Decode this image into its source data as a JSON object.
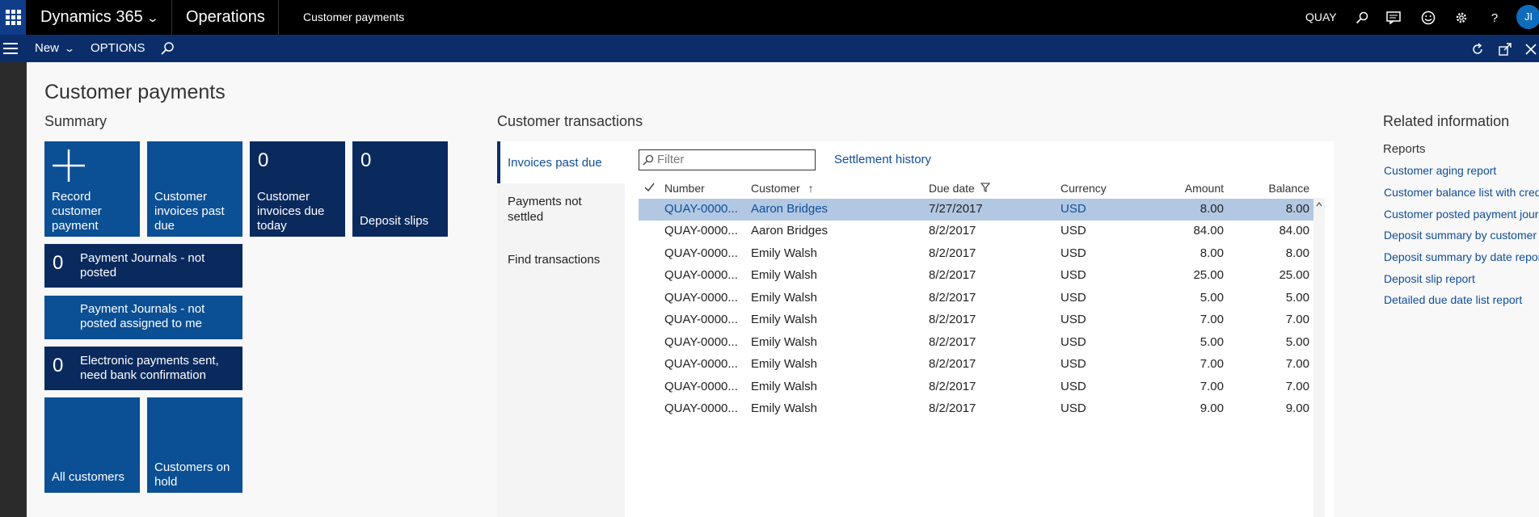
{
  "topbar": {
    "brand": "Dynamics 365",
    "module": "Operations",
    "page": "Customer payments",
    "company": "QUAY",
    "user_initials": "JI",
    "icons": [
      "search-icon",
      "message-icon",
      "smiley-icon",
      "gear-icon",
      "help-icon"
    ]
  },
  "actionbar": {
    "new_label": "New",
    "options_label": "OPTIONS"
  },
  "page_title": "Customer payments",
  "summary": {
    "heading": "Summary",
    "tiles": {
      "record_payment": "Record customer payment",
      "invoices_past_due": "Customer invoices past due",
      "invoices_due_today_count": "0",
      "invoices_due_today": "Customer invoices due today",
      "deposit_slips_count": "0",
      "deposit_slips": "Deposit slips",
      "journals_not_posted_count": "0",
      "journals_not_posted": "Payment Journals - not posted",
      "journals_assigned": "Payment Journals - not posted assigned to me",
      "electronic_count": "0",
      "electronic": "Electronic payments sent, need bank confirmation",
      "all_customers": "All customers",
      "customers_on_hold": "Customers on hold"
    }
  },
  "transactions": {
    "heading": "Customer transactions",
    "tabs": [
      "Invoices past due",
      "Payments not settled",
      "Find transactions"
    ],
    "filter_placeholder": "Filter",
    "settlement_link": "Settlement history",
    "columns": {
      "number": "Number",
      "customer": "Customer",
      "due_date": "Due date",
      "currency": "Currency",
      "amount": "Amount",
      "balance": "Balance"
    },
    "rows": [
      {
        "number": "QUAY-0000...",
        "customer": "Aaron Bridges",
        "due": "7/27/2017",
        "currency": "USD",
        "amount": "8.00",
        "balance": "8.00"
      },
      {
        "number": "QUAY-0000...",
        "customer": "Aaron Bridges",
        "due": "8/2/2017",
        "currency": "USD",
        "amount": "84.00",
        "balance": "84.00"
      },
      {
        "number": "QUAY-0000...",
        "customer": "Emily Walsh",
        "due": "8/2/2017",
        "currency": "USD",
        "amount": "8.00",
        "balance": "8.00"
      },
      {
        "number": "QUAY-0000...",
        "customer": "Emily Walsh",
        "due": "8/2/2017",
        "currency": "USD",
        "amount": "25.00",
        "balance": "25.00"
      },
      {
        "number": "QUAY-0000...",
        "customer": "Emily Walsh",
        "due": "8/2/2017",
        "currency": "USD",
        "amount": "5.00",
        "balance": "5.00"
      },
      {
        "number": "QUAY-0000...",
        "customer": "Emily Walsh",
        "due": "8/2/2017",
        "currency": "USD",
        "amount": "7.00",
        "balance": "7.00"
      },
      {
        "number": "QUAY-0000...",
        "customer": "Emily Walsh",
        "due": "8/2/2017",
        "currency": "USD",
        "amount": "5.00",
        "balance": "5.00"
      },
      {
        "number": "QUAY-0000...",
        "customer": "Emily Walsh",
        "due": "8/2/2017",
        "currency": "USD",
        "amount": "7.00",
        "balance": "7.00"
      },
      {
        "number": "QUAY-0000...",
        "customer": "Emily Walsh",
        "due": "8/2/2017",
        "currency": "USD",
        "amount": "7.00",
        "balance": "7.00"
      },
      {
        "number": "QUAY-0000...",
        "customer": "Emily Walsh",
        "due": "8/2/2017",
        "currency": "USD",
        "amount": "9.00",
        "balance": "9.00"
      }
    ]
  },
  "related": {
    "heading": "Related information",
    "reports_label": "Reports",
    "links": [
      "Customer aging report",
      "Customer balance list with credi",
      "Customer posted payment journ",
      "Deposit summary by customer",
      "Deposit summary by date repor",
      "Deposit slip report",
      "Detailed due date list report"
    ]
  },
  "colors": {
    "topbar": "#000000",
    "actionbar": "#0b2e6b",
    "tile": "#0b4f95",
    "tile_dark": "#0a2a5e",
    "link": "#0f4d9a",
    "selected_row": "#b2c8e2"
  }
}
